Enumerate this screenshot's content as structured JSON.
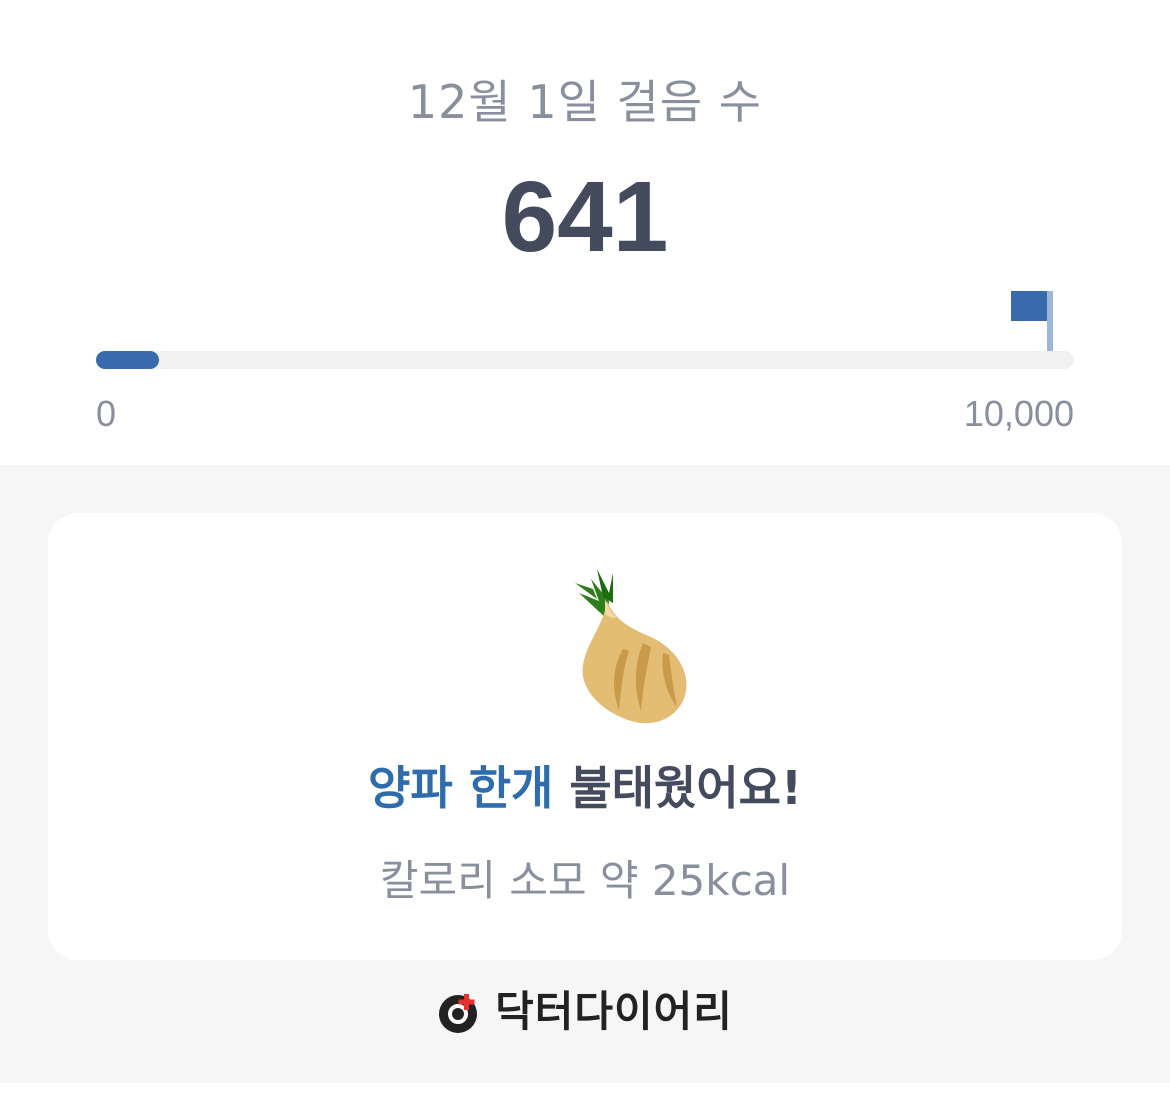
{
  "steps": {
    "date_title": "12월 1일 걸음 수",
    "count": "641",
    "goal_progress_fraction": 0.0641,
    "scale_min": "0",
    "scale_max": "10,000"
  },
  "burn_card": {
    "food_icon": "onion-icon",
    "food_text": "양파 한개",
    "burn_text": " 불태웠어요!",
    "calorie_text": "칼로리 소모 약 25kcal"
  },
  "brand": {
    "logo_icon": "doctor-diary-logo-icon",
    "name": "닥터다이어리"
  },
  "colors": {
    "accent_blue": "#3a6aae",
    "food_blue": "#2f6cad",
    "text_dark": "#444b5c",
    "text_gray": "#8a8f9e",
    "logo_red": "#e8312f"
  }
}
